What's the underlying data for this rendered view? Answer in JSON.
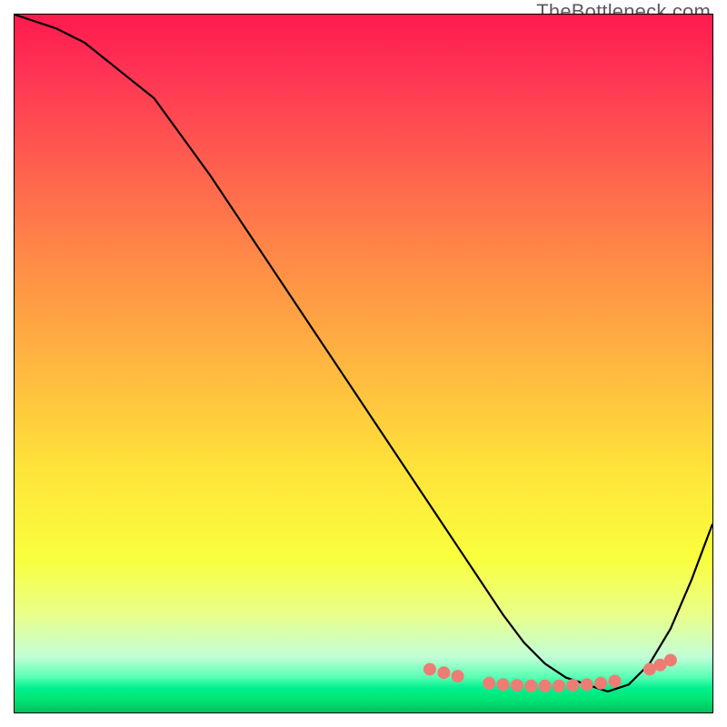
{
  "watermark": "TheBottleneck.com",
  "chart_data": {
    "type": "line",
    "title": "",
    "xlabel": "",
    "ylabel": "",
    "xlim": [
      0,
      100
    ],
    "ylim": [
      0,
      100
    ],
    "grid": false,
    "legend": false,
    "series": [
      {
        "name": "curve",
        "x": [
          0,
          3,
          6,
          10,
          15,
          20,
          28,
          36,
          44,
          52,
          60,
          66,
          70,
          73,
          76,
          79,
          82,
          85,
          88,
          91,
          94,
          97,
          100
        ],
        "values": [
          100,
          99,
          98,
          96,
          92,
          88,
          77,
          65,
          53,
          41,
          29,
          20,
          14,
          10,
          7,
          5,
          4,
          3,
          4,
          7,
          12,
          19,
          27
        ]
      }
    ],
    "markers": {
      "name": "dots",
      "x": [
        59.5,
        61.5,
        63.5,
        68.0,
        70.0,
        72.0,
        74.0,
        76.0,
        78.0,
        80.0,
        82.0,
        84.0,
        86.0,
        91.0,
        92.5,
        94.0
      ],
      "values": [
        6.2,
        5.7,
        5.2,
        4.2,
        4.0,
        3.9,
        3.8,
        3.8,
        3.8,
        3.9,
        4.0,
        4.2,
        4.5,
        6.2,
        6.8,
        7.5
      ]
    },
    "gradient_stops": [
      {
        "offset": 0,
        "color": "#ff1a4d"
      },
      {
        "offset": 0.08,
        "color": "#ff3355"
      },
      {
        "offset": 0.2,
        "color": "#ff5a4f"
      },
      {
        "offset": 0.35,
        "color": "#ff8a47"
      },
      {
        "offset": 0.5,
        "color": "#ffb640"
      },
      {
        "offset": 0.65,
        "color": "#ffe33a"
      },
      {
        "offset": 0.78,
        "color": "#f9ff3d"
      },
      {
        "offset": 0.86,
        "color": "#e9ff8a"
      },
      {
        "offset": 0.92,
        "color": "#c2ffd7"
      },
      {
        "offset": 0.95,
        "color": "#56ffb3"
      },
      {
        "offset": 0.965,
        "color": "#00f090"
      },
      {
        "offset": 0.98,
        "color": "#00e676"
      },
      {
        "offset": 1.0,
        "color": "#00c060"
      }
    ],
    "marker_color": "#ed7d74",
    "line_color": "#000000"
  }
}
